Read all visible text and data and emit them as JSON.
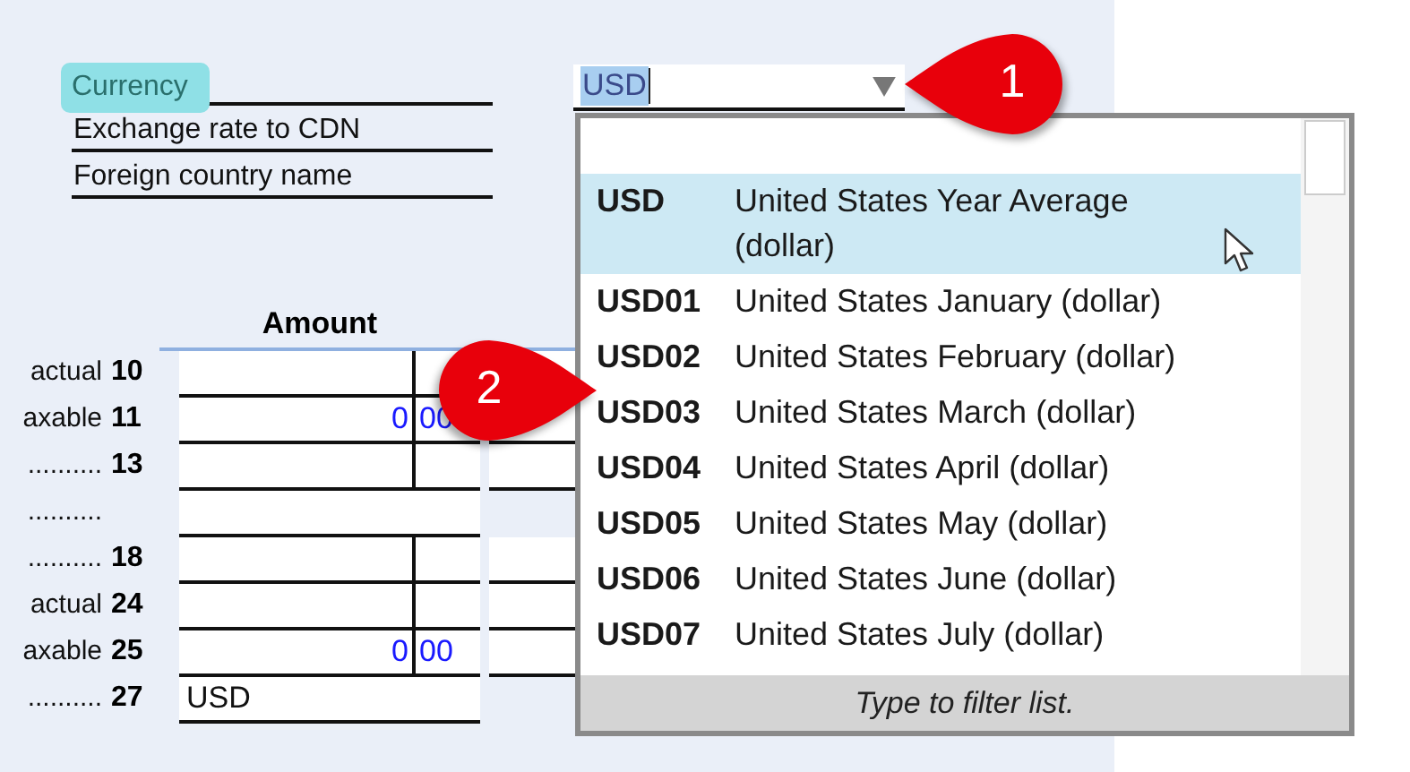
{
  "form": {
    "fields": [
      {
        "label": "Currency",
        "highlighted": true
      },
      {
        "label": "Exchange rate to CDN",
        "highlighted": false
      },
      {
        "label": "Foreign country name",
        "highlighted": false
      }
    ],
    "currency_select": {
      "value": "USD",
      "text_selected": true
    }
  },
  "amount_table": {
    "heading": "Amount",
    "rows": [
      {
        "label": "actual",
        "line": "10",
        "split": true,
        "side_cell": true
      },
      {
        "label": "axable",
        "line": "11",
        "dollars": "0",
        "cents": "00",
        "split": true,
        "side_cell": true
      },
      {
        "label": "..........",
        "line": "13",
        "split": true,
        "side_cell": true
      },
      {
        "label": "..........",
        "split": false,
        "side_cell": false
      },
      {
        "label": "..........",
        "line": "18",
        "split": true,
        "side_cell": true
      },
      {
        "label": "actual",
        "line": "24",
        "split": true,
        "side_cell": true
      },
      {
        "label": "axable",
        "line": "25",
        "dollars": "0",
        "cents": "00",
        "split": true,
        "side_cell": true
      },
      {
        "label": "..........",
        "line": "27",
        "text": "USD",
        "split": false,
        "side_cell": false
      }
    ]
  },
  "dropdown": {
    "items": [
      {
        "code": "USD",
        "name": "United States Year Average (dollar)",
        "selected": true
      },
      {
        "code": "USD01",
        "name": "United States January (dollar)",
        "selected": false
      },
      {
        "code": "USD02",
        "name": "United States February (dollar)",
        "selected": false
      },
      {
        "code": "USD03",
        "name": "United States March (dollar)",
        "selected": false
      },
      {
        "code": "USD04",
        "name": "United States April (dollar)",
        "selected": false
      },
      {
        "code": "USD05",
        "name": "United States May (dollar)",
        "selected": false
      },
      {
        "code": "USD06",
        "name": "United States June (dollar)",
        "selected": false
      },
      {
        "code": "USD07",
        "name": "United States July (dollar)",
        "selected": false
      }
    ],
    "footer": "Type to filter list."
  },
  "callouts": [
    {
      "number": "1",
      "kind": "left"
    },
    {
      "number": "2",
      "kind": "right"
    }
  ]
}
